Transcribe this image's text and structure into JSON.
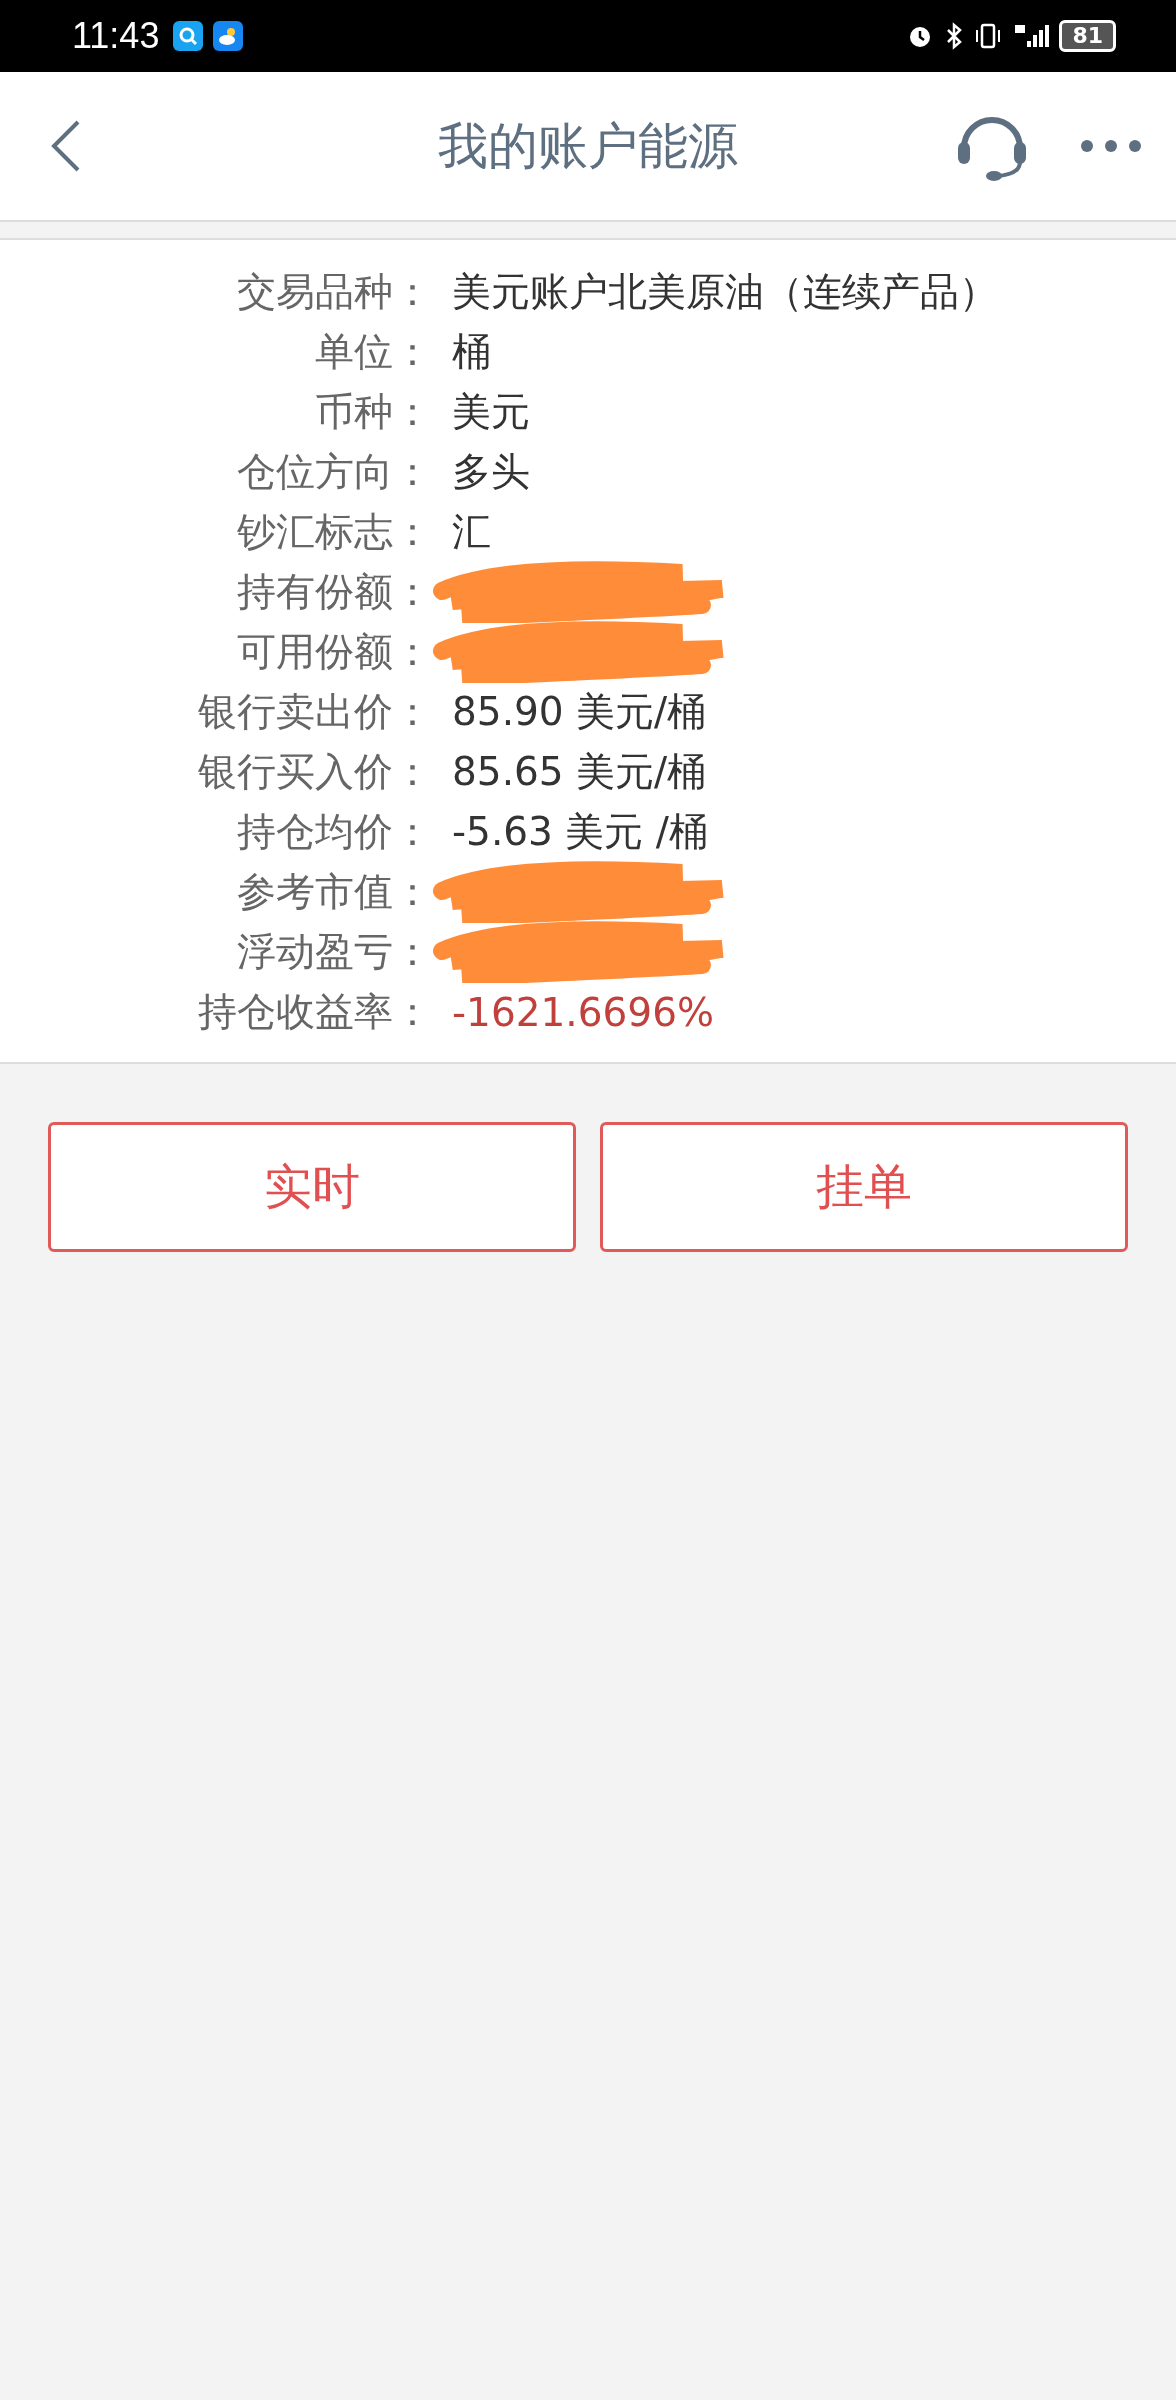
{
  "status_bar": {
    "time": "11:43",
    "battery": "81"
  },
  "header": {
    "title": "我的账户能源"
  },
  "details": [
    {
      "kind": "value",
      "label": "交易品种：",
      "value": "美元账户北美原油（连续产品）",
      "color": "#333333"
    },
    {
      "kind": "value",
      "label": "单位：",
      "value": "桶",
      "color": "#333333"
    },
    {
      "kind": "value",
      "label": "币种：",
      "value": "美元",
      "color": "#333333"
    },
    {
      "kind": "value",
      "label": "仓位方向：",
      "value": "多头",
      "color": "#333333"
    },
    {
      "kind": "value",
      "label": "钞汇标志：",
      "value": "汇",
      "color": "#333333"
    },
    {
      "kind": "redacted",
      "label": "持有份额："
    },
    {
      "kind": "redacted",
      "label": "可用份额："
    },
    {
      "kind": "value",
      "label": "银行卖出价：",
      "value": "85.90 美元/桶",
      "color": "#333333"
    },
    {
      "kind": "value",
      "label": "银行买入价：",
      "value": "85.65 美元/桶",
      "color": "#333333"
    },
    {
      "kind": "value",
      "label": "持仓均价：",
      "value": "-5.63 美元 /桶",
      "color": "#333333"
    },
    {
      "kind": "redacted",
      "label": "参考市值："
    },
    {
      "kind": "redacted",
      "label": "浮动盈亏："
    },
    {
      "kind": "value",
      "label": "持仓收益率：",
      "value": "-1621.6696%",
      "color": "#c0403c"
    }
  ],
  "buttons": [
    "实时",
    "挂单"
  ]
}
